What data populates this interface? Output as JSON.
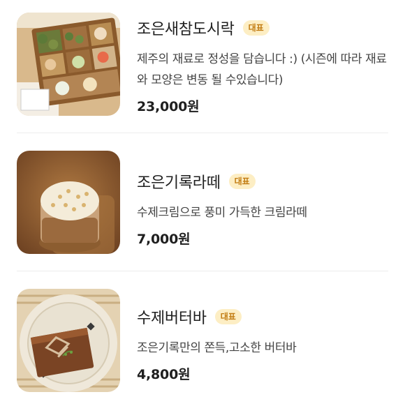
{
  "menu": {
    "items": [
      {
        "name": "조은새참도시락",
        "badge": "대표",
        "description": "제주의 재료로 정성을 담습니다 :) (시즌에 따라 재료와 모양은 변동 될 수있습니다)",
        "price": "23,000원",
        "image_icon": "lunchbox-photo"
      },
      {
        "name": "조은기록라떼",
        "badge": "대표",
        "description": "수제크림으로 풍미 가득한 크림라떼",
        "price": "7,000원",
        "image_icon": "latte-photo"
      },
      {
        "name": "수제버터바",
        "badge": "대표",
        "description": "조은기록만의 쫀득,고소한 버터바",
        "price": "4,800원",
        "image_icon": "butterbar-photo"
      }
    ],
    "colors": {
      "badge_bg": "#fdeec4",
      "badge_text": "#c27c12",
      "divider": "#ececec"
    }
  }
}
